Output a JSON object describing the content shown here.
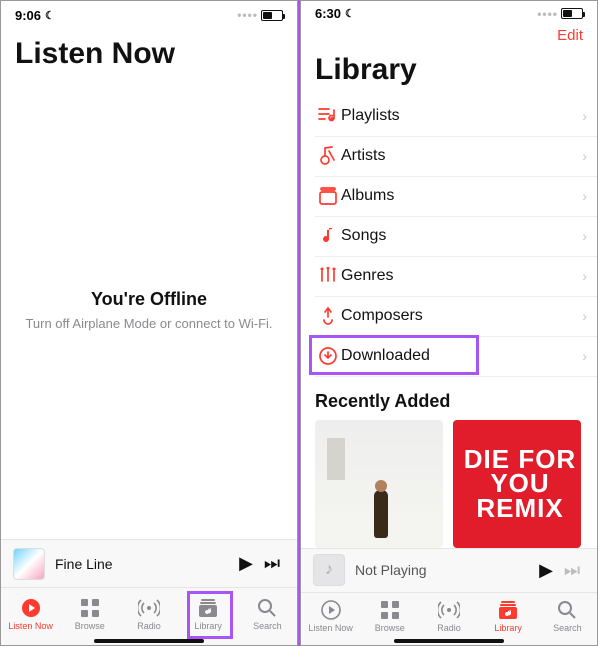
{
  "left": {
    "status_time": "9:06",
    "title": "Listen Now",
    "offline_title": "You're Offline",
    "offline_sub": "Turn off Airplane Mode or connect to Wi-Fi.",
    "mini_track": "Fine Line"
  },
  "right": {
    "status_time": "6:30",
    "edit": "Edit",
    "title": "Library",
    "recent_title": "Recently Added",
    "album2_l1": "DIE FOR",
    "album2_l2": "YOU",
    "album2_l3": "REMIX",
    "mini_track": "Not Playing"
  },
  "library_items": [
    {
      "label": "Playlists",
      "icon": "playlists-icon"
    },
    {
      "label": "Artists",
      "icon": "artists-icon"
    },
    {
      "label": "Albums",
      "icon": "albums-icon"
    },
    {
      "label": "Songs",
      "icon": "songs-icon"
    },
    {
      "label": "Genres",
      "icon": "genres-icon"
    },
    {
      "label": "Composers",
      "icon": "composers-icon"
    },
    {
      "label": "Downloaded",
      "icon": "downloaded-icon",
      "highlight": true
    }
  ],
  "tabs": [
    {
      "label": "Listen Now",
      "icon": "play-circle-icon"
    },
    {
      "label": "Browse",
      "icon": "grid-icon"
    },
    {
      "label": "Radio",
      "icon": "radio-icon"
    },
    {
      "label": "Library",
      "icon": "library-tab-icon"
    },
    {
      "label": "Search",
      "icon": "search-icon"
    }
  ],
  "colors": {
    "accent": "#ff3b30",
    "highlight": "#a855f7"
  }
}
